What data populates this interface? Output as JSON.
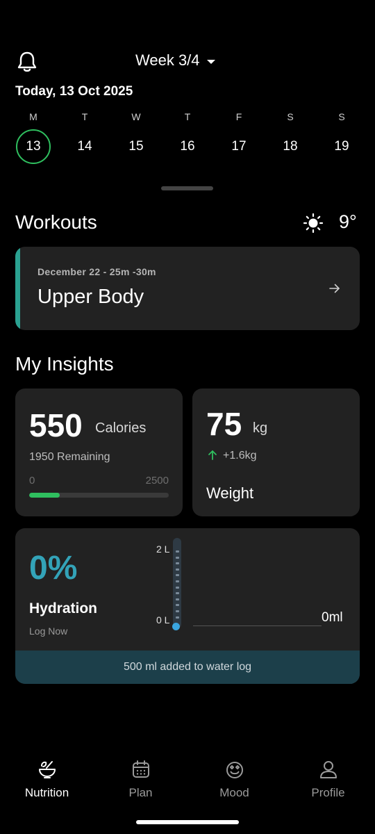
{
  "header": {
    "week_label": "Week 3/4",
    "today_label": "Today, 13 Oct 2025"
  },
  "calendar": {
    "days": [
      {
        "letter": "M",
        "number": "13",
        "selected": true
      },
      {
        "letter": "T",
        "number": "14",
        "selected": false
      },
      {
        "letter": "W",
        "number": "15",
        "selected": false
      },
      {
        "letter": "T",
        "number": "16",
        "selected": false
      },
      {
        "letter": "F",
        "number": "17",
        "selected": false
      },
      {
        "letter": "S",
        "number": "18",
        "selected": false
      },
      {
        "letter": "S",
        "number": "19",
        "selected": false
      }
    ],
    "selected_color": "#2fbf5f"
  },
  "workouts": {
    "title": "Workouts",
    "temperature": "9°",
    "weather_icon": "sun-icon",
    "card": {
      "meta": "December 22 - 25m -30m",
      "title": "Upper Body",
      "accent_color": "#2aa191"
    }
  },
  "insights": {
    "title": "My Insights",
    "calories": {
      "value": "550",
      "unit": "Calories",
      "remaining": "1950 Remaining",
      "min_label": "0",
      "max_label": "2500",
      "progress": 0.22,
      "bar_color": "#2fbf5f"
    },
    "weight": {
      "value": "75",
      "unit": "kg",
      "change": "+1.6kg",
      "change_color": "#2fbf5f",
      "label": "Weight"
    },
    "hydration": {
      "percent": "0%",
      "label": "Hydration",
      "log_label": "Log Now",
      "scale_top": "2 L",
      "scale_bottom": "0 L",
      "amount": "0ml",
      "level": 0,
      "toast": "500 ml added to water log",
      "accent_color": "#33a3b8"
    }
  },
  "nav": {
    "items": [
      {
        "label": "Nutrition",
        "icon": "nutrition-icon",
        "active": true
      },
      {
        "label": "Plan",
        "icon": "calendar-icon",
        "active": false
      },
      {
        "label": "Mood",
        "icon": "mood-icon",
        "active": false
      },
      {
        "label": "Profile",
        "icon": "profile-icon",
        "active": false
      }
    ]
  }
}
